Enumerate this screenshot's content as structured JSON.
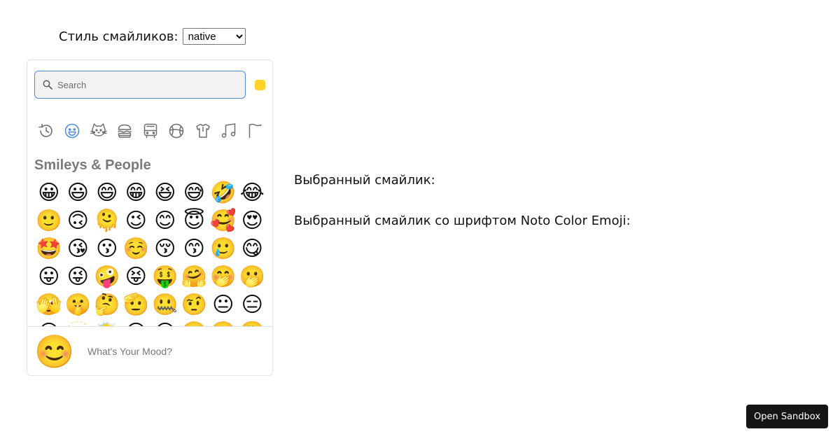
{
  "style_selector": {
    "label": "Стиль смайликов:",
    "selected": "native"
  },
  "picker": {
    "search": {
      "placeholder": "Search",
      "value": ""
    },
    "skin_tone_color": "#ffd225",
    "categories": [
      {
        "name": "frequently-used",
        "icon": "clock-history-icon",
        "active": false
      },
      {
        "name": "smileys-people",
        "icon": "smiley-icon",
        "active": true
      },
      {
        "name": "animals-nature",
        "icon": "cat-icon",
        "active": false
      },
      {
        "name": "food-drink",
        "icon": "burger-icon",
        "active": false
      },
      {
        "name": "travel-places",
        "icon": "bus-icon",
        "active": false
      },
      {
        "name": "activities",
        "icon": "ball-icon",
        "active": false
      },
      {
        "name": "objects",
        "icon": "shirt-icon",
        "active": false
      },
      {
        "name": "symbols",
        "icon": "music-note-icon",
        "active": false
      },
      {
        "name": "flags",
        "icon": "flag-icon",
        "active": false
      }
    ],
    "category_title": "Smileys & People",
    "emojis": [
      "😀",
      "😃",
      "😄",
      "😁",
      "😆",
      "😅",
      "🤣",
      "😂",
      "🙂",
      "🙃",
      "🫠",
      "😉",
      "😊",
      "😇",
      "🥰",
      "😍",
      "🤩",
      "😘",
      "😗",
      "☺️",
      "😚",
      "😙",
      "🥲",
      "😋",
      "😛",
      "😜",
      "🤪",
      "😝",
      "🤑",
      "🤗",
      "🤭",
      "🫢",
      "🫣",
      "🤫",
      "🤔",
      "🫡",
      "🤐",
      "🤨",
      "😐",
      "😑",
      "😶",
      "🫥",
      "😶‍🌫️",
      "😏",
      "😒",
      "🙄",
      "😬",
      "😮‍💨"
    ],
    "preview": {
      "emoji": "😊",
      "text": "What's Your Mood?"
    }
  },
  "selected_label": "Выбранный смайлик:",
  "selected_noto_label": "Выбранный смайлик со шрифтом Noto Color Emoji:",
  "open_sandbox_label": "Open Sandbox",
  "accent_color": "#4f8ed6"
}
